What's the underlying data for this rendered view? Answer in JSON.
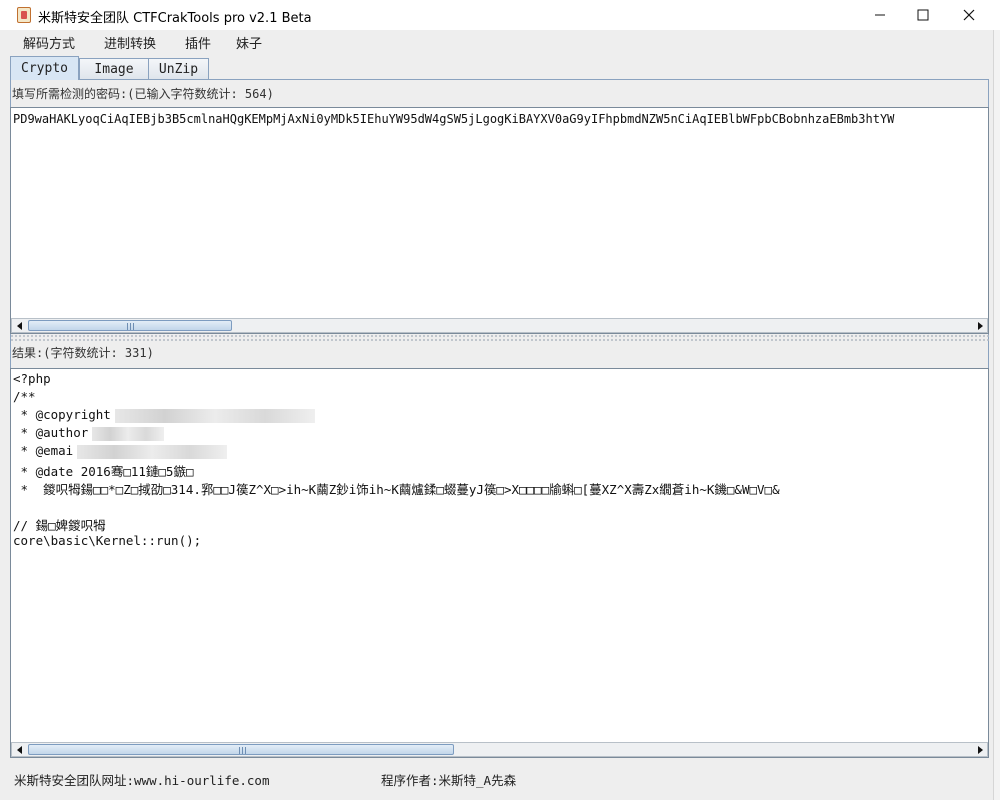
{
  "window": {
    "title": "米斯特安全团队 CTFCrakTools pro v2.1 Beta",
    "minimize_glyph": "—",
    "maximize_glyph": "☐",
    "close_glyph": "✕"
  },
  "menu": {
    "items": [
      "解码方式",
      "进制转换",
      "插件",
      "妹子"
    ]
  },
  "tabs": [
    "Crypto",
    "Image",
    "UnZip"
  ],
  "input": {
    "label": "填写所需检测的密码:(已输入字符数统计: 564)",
    "value": "PD9waHAKLyoqCiAqIEBjb3B5cmlnaHQgKEMpMjAxNi0yMDk5IEhuYW95dW4gSW5jLgogKiBAYXV0aG9yIFhpbmdNZW5nCiAqIEBlbWFpbCBobnhzaEBmb3htYW"
  },
  "output": {
    "label": "结果:(字符数统计: 331)",
    "lines": [
      "<?php",
      "/**",
      " * @copyright",
      " * @author",
      " * @emai",
      " * @date 2016骞□11鏈□5鏃□",
      " *  鍐呮牳鍚□□*□Z□掝劭□314.郛□□J篌Z^X□>ih~K繭Z鈔i饰ih~K繭爐鍒□蝃蔓yJ篌□>X□□□□牏蝌□[蔓XZ^X壽Zx繝蒼ih~K鐖□&W□V□&",
      "",
      "// 鍚□婢鍐呮牳",
      "core\\basic\\Kernel::run();"
    ]
  },
  "status": {
    "website": "米斯特安全团队网址:www.hi-ourlife.com",
    "author": "程序作者:米斯特_A先森"
  }
}
